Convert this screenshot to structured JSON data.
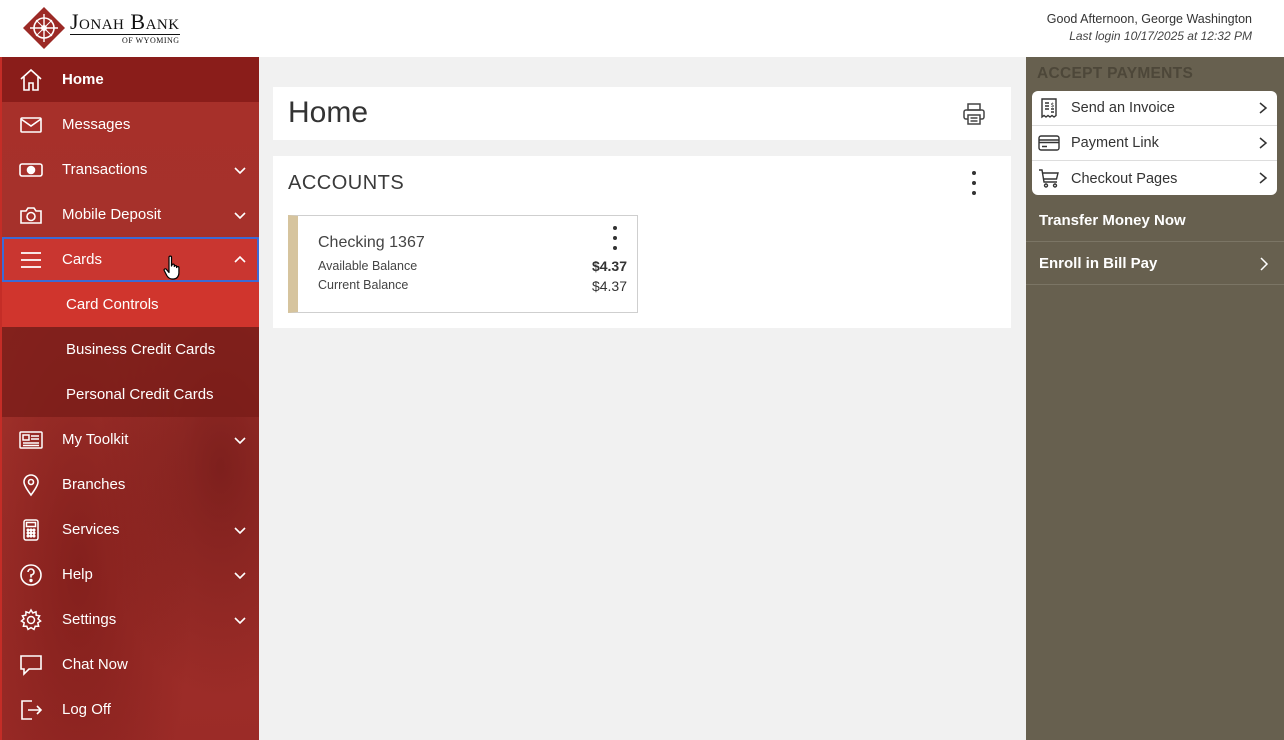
{
  "header": {
    "bank_name": "Jonah Bank",
    "bank_sub": "of Wyoming",
    "greeting": "Good Afternoon, George Washington",
    "last_login": "Last login 10/17/2025 at 12:32 PM"
  },
  "sidebar": {
    "items": [
      {
        "label": "Home",
        "icon": "home-icon"
      },
      {
        "label": "Messages",
        "icon": "envelope-icon"
      },
      {
        "label": "Transactions",
        "icon": "cash-icon"
      },
      {
        "label": "Mobile Deposit",
        "icon": "camera-icon"
      },
      {
        "label": "Cards",
        "icon": "menu-icon"
      },
      {
        "label": "My Toolkit",
        "icon": "newspaper-icon"
      },
      {
        "label": "Branches",
        "icon": "map-pin-icon"
      },
      {
        "label": "Services",
        "icon": "calculator-icon"
      },
      {
        "label": "Help",
        "icon": "question-icon"
      },
      {
        "label": "Settings",
        "icon": "gear-icon"
      },
      {
        "label": "Chat Now",
        "icon": "chat-icon"
      },
      {
        "label": "Log Off",
        "icon": "logout-icon"
      }
    ],
    "cards_sub": [
      "Card Controls",
      "Business Credit Cards",
      "Personal Credit Cards"
    ]
  },
  "main": {
    "title": "Home",
    "accounts_heading": "ACCOUNTS",
    "account": {
      "name": "Checking 1367",
      "available_label": "Available Balance",
      "available_value": "$4.37",
      "current_label": "Current Balance",
      "current_value": "$4.37"
    }
  },
  "right_panel": {
    "heading": "ACCEPT PAYMENTS",
    "items": [
      "Send an Invoice",
      "Payment Link",
      "Checkout Pages"
    ],
    "transfer": "Transfer Money Now",
    "bill_pay": "Enroll in Bill Pay"
  },
  "colors": {
    "sidebar_red": "#a3322c",
    "home_active": "#8a1d1a",
    "cards_open": "#c93630",
    "right_panel": "#67604f",
    "account_accent": "#d6c49e"
  }
}
